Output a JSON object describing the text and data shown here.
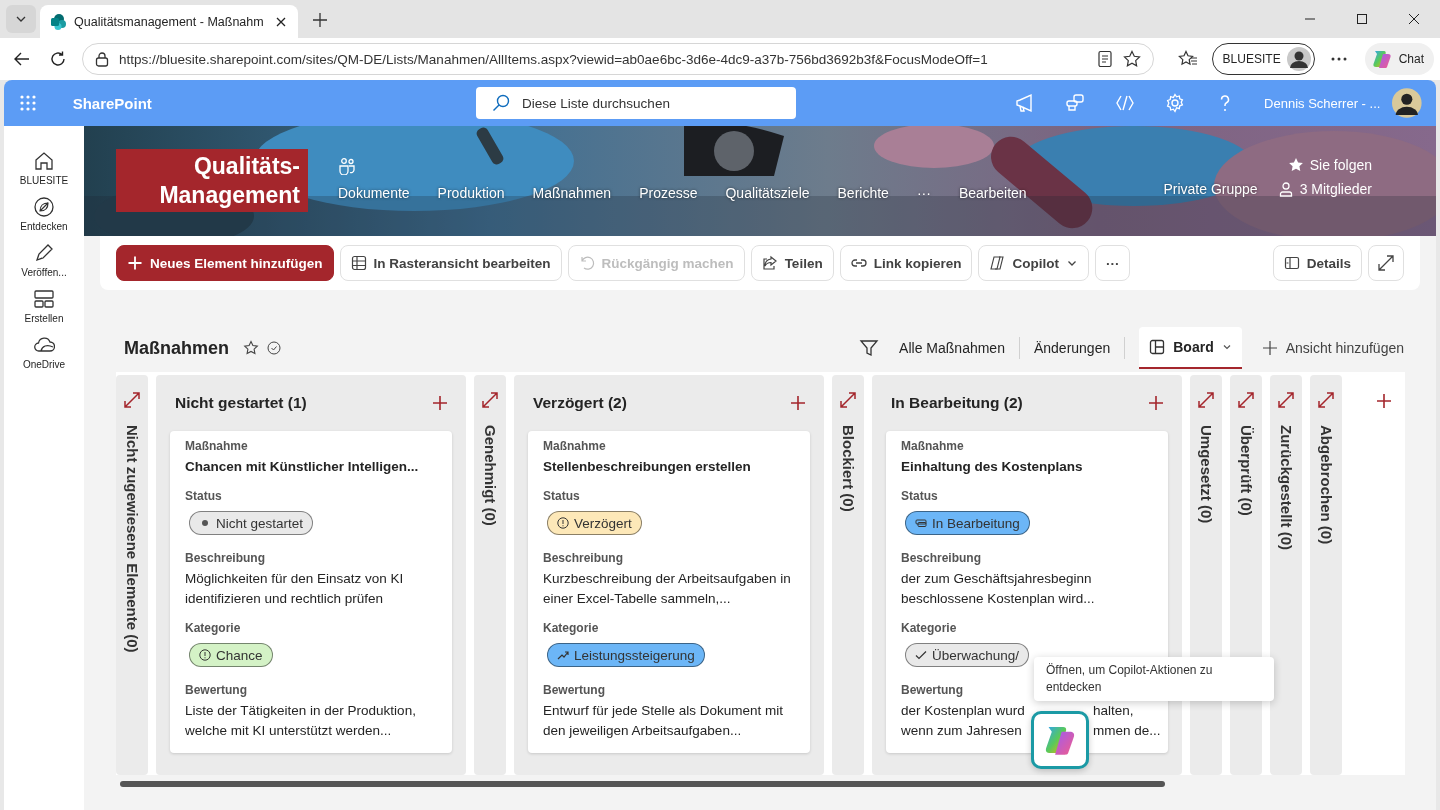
{
  "browser": {
    "tab_title": "Qualitätsmanagement - Maßnahm",
    "url": "https://bluesite.sharepoint.com/sites/QM-DE/Lists/Manahmen/AllItems.aspx?viewid=ab0ae6bc-3d6e-4dc9-a37b-756bd3692b3f&FocusModeOff=1",
    "profile": "BLUESITE",
    "chat": "Chat"
  },
  "suite_bar": {
    "app": "SharePoint",
    "search": {
      "placeholder": "Diese Liste durchsuchen"
    },
    "user": "Dennis Scherrer - ..."
  },
  "rail": [
    {
      "label": "BLUESITE"
    },
    {
      "label": "Entdecken"
    },
    {
      "label": "Veröffen..."
    },
    {
      "label": "Erstellen"
    },
    {
      "label": "OneDrive"
    }
  ],
  "site": {
    "logo": [
      "Qualitäts-",
      "Management"
    ],
    "nav": [
      "Dokumente",
      "Produktion",
      "Maßnahmen",
      "Prozesse",
      "Qualitätsziele",
      "Berichte",
      "···",
      "Bearbeiten"
    ],
    "group": "Private Gruppe",
    "follow": "Sie folgen",
    "members": "3 Mitglieder"
  },
  "commands": [
    {
      "kind": "primary",
      "label": "Neues Element hinzufügen",
      "disabled": false
    },
    {
      "kind": "default",
      "label": "In Rasteransicht bearbeiten",
      "disabled": false
    },
    {
      "kind": "default",
      "label": "Rückgängig machen",
      "disabled": true
    },
    {
      "kind": "default",
      "label": "Teilen",
      "disabled": false
    },
    {
      "kind": "default",
      "label": "Link kopieren",
      "disabled": false
    },
    {
      "kind": "dropdown",
      "label": "Copilot",
      "disabled": false
    },
    {
      "kind": "more",
      "label": "···",
      "disabled": false
    }
  ],
  "details_button": "Details",
  "list": {
    "title": "Maßnahmen",
    "views": [
      {
        "label": "Alle Maßnahmen",
        "selected": false
      },
      {
        "label": "Änderungen",
        "selected": false
      },
      {
        "label": "Board",
        "selected": true
      }
    ],
    "add_view": "Ansicht hinzufügen"
  },
  "board": {
    "columns": [
      {
        "kind": "collapsed",
        "title": "Nicht zugewiesene Elemente (0)"
      },
      {
        "kind": "expanded",
        "title": "Nicht gestartet (1)",
        "cards": [
          {
            "fields": [
              {
                "kind": "title",
                "label": "Maßnahme",
                "value": "Chancen mit Künstlicher Intelligen..."
              },
              {
                "kind": "tag",
                "label": "Status",
                "value": "Nicht gestartet",
                "color": "#e9e9e9"
              },
              {
                "kind": "text",
                "label": "Beschreibung",
                "value": "Möglichkeiten für den Einsatz von KI identifizieren und rechtlich prüfen"
              },
              {
                "kind": "tag",
                "label": "Kategorie",
                "value": "Chance",
                "color": "#d4f2c6"
              },
              {
                "kind": "text",
                "label": "Bewertung",
                "value": "Liste der Tätigkeiten in der Produktion, welche mit KI unterstützt werden..."
              }
            ]
          }
        ]
      },
      {
        "kind": "collapsed",
        "title": "Genehmigt (0)"
      },
      {
        "kind": "expanded",
        "title": "Verzögert (2)",
        "cards": [
          {
            "fields": [
              {
                "kind": "title",
                "label": "Maßnahme",
                "value": "Stellenbeschreibungen erstellen"
              },
              {
                "kind": "tag",
                "label": "Status",
                "value": "Verzögert",
                "color": "#fde8b8"
              },
              {
                "kind": "text",
                "label": "Beschreibung",
                "value": "Kurzbeschreibung der Arbeitsaufgaben in einer Excel-Tabelle sammeln,..."
              },
              {
                "kind": "tag",
                "label": "Kategorie",
                "value": "Leistungssteigerung",
                "color": "#6cb6f7"
              },
              {
                "kind": "text",
                "label": "Bewertung",
                "value": "Entwurf für jede Stelle als Dokument mit den jeweiligen Arbeitsaufgaben..."
              }
            ]
          }
        ]
      },
      {
        "kind": "collapsed",
        "title": "Blockiert (0)"
      },
      {
        "kind": "expanded",
        "title": "In Bearbeitung (2)",
        "cards": [
          {
            "fields": [
              {
                "kind": "title",
                "label": "Maßnahme",
                "value": "Einhaltung des Kostenplans"
              },
              {
                "kind": "tag",
                "label": "Status",
                "value": "In Bearbeitung",
                "color": "#6cb6f7"
              },
              {
                "kind": "text",
                "label": "Beschreibung",
                "value": "der zum Geschäftsjahresbeginn beschlossene Kostenplan wird..."
              },
              {
                "kind": "tag",
                "label": "Kategorie",
                "value": "Überwachung/",
                "color": "#e9e9e9"
              },
              {
                "kind": "covered_text",
                "label": "Bewertung",
                "lines": [
                  [
                    "der Kostenplan wurd",
                    "halten,"
                  ],
                  [
                    "wenn zum Jahresen",
                    "mmen de..."
                  ]
                ]
              }
            ]
          }
        ]
      },
      {
        "kind": "collapsed",
        "title": "Umgesetzt (0)"
      },
      {
        "kind": "collapsed",
        "title": "Überprüft (0)"
      },
      {
        "kind": "collapsed",
        "title": "Zurückgestellt (0)"
      },
      {
        "kind": "collapsed",
        "title": "Abgebrochen (0)"
      }
    ]
  },
  "tooltip": "Öffnen, um Copilot-Aktionen zu entdecken"
}
